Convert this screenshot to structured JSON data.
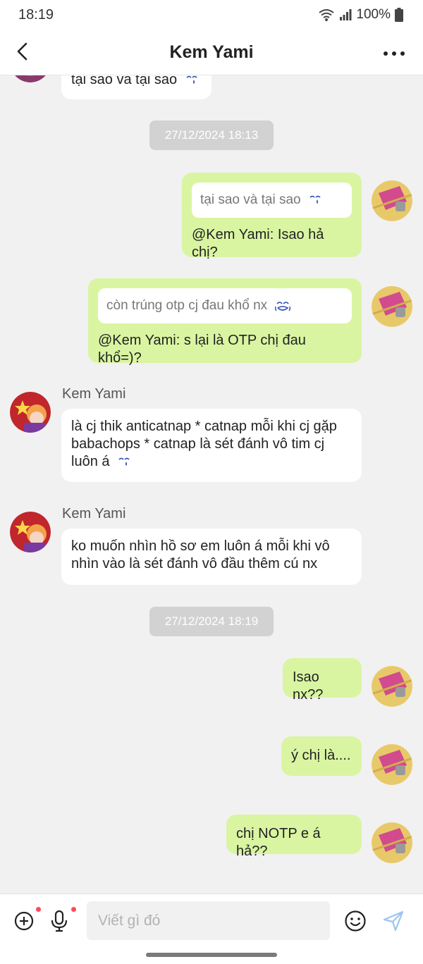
{
  "status_bar": {
    "time": "18:19",
    "battery": "100%"
  },
  "header": {
    "title": "Kem Yami",
    "back_icon": "chevron-left-icon",
    "more_icon": "more-horizontal-icon"
  },
  "messages": {
    "m0": {
      "text": "tại sao và tại sao"
    },
    "ts1": "27/12/2024 18:13",
    "m1": {
      "quote": "tại sao và tại sao",
      "text": "@Kem Yami: Isao hả chị?"
    },
    "m2": {
      "quote": "còn trúng otp cj đau khổ nx",
      "text": "@Kem Yami: s lại là OTP chị đau khổ=)?"
    },
    "m3": {
      "sender": "Kem Yami",
      "text": "là cj thik anticatnap * catnap mỗi khi cj gặp babachops * catnap là sét đánh vô tim cj luôn á"
    },
    "m4": {
      "sender": "Kem Yami",
      "text": "ko muốn nhìn hồ sơ em luôn á mỗi khi vô nhìn vào là sét đánh vô đầu thêm cú nx"
    },
    "ts2": "27/12/2024 18:19",
    "m5": {
      "text": "Isao nx??"
    },
    "m6": {
      "text": "ý chị là...."
    },
    "m7": {
      "text": "chị NOTP e á hả??"
    }
  },
  "composer": {
    "placeholder": "Viết gì đó",
    "icons": [
      "add-circle-icon",
      "microphone-icon",
      "emoji-icon",
      "send-icon"
    ]
  },
  "colors": {
    "outgoing_bubble": "#d9f5a2",
    "incoming_bubble": "#ffffff",
    "background": "#f1f1f1",
    "timestamp_bg": "#d2d2d2",
    "notification_dot": "#ff4a5a"
  }
}
